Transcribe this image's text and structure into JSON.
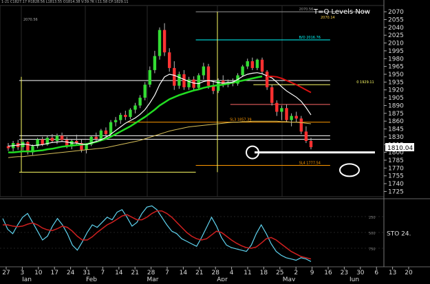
{
  "header": {
    "left_line": "1-21  C1827.17  H1828.56  L1813.55  O1814.38  V:39.7K  I:11.58  CP:1829.11",
    "sub_line": "2070.56",
    "title": "T=Q Levels Now",
    "title_sub": "2070.14"
  },
  "chart_data": [
    {
      "type": "candlestick",
      "name": "price",
      "ylim": [
        1715,
        2082
      ],
      "y_ticks": [
        2070,
        2055,
        2040,
        2025,
        2010,
        1995,
        1980,
        1965,
        1950,
        1935,
        1920,
        1905,
        1890,
        1875,
        1860,
        1845,
        1830,
        1815,
        1800,
        1785,
        1770,
        1755,
        1740,
        1725
      ],
      "last_price": "1810.04",
      "x_ticks": [
        "27",
        "3",
        "10",
        "17",
        "24",
        "31",
        "7",
        "14",
        "21",
        "28",
        "7",
        "14",
        "21",
        "28",
        "4",
        "11",
        "18",
        "25",
        "2",
        "9",
        "16",
        "23",
        "30",
        "6",
        "13",
        "20"
      ],
      "months": [
        "Jan",
        "Feb",
        "Mar",
        "Apr",
        "May",
        "Jun"
      ],
      "candles": [
        {
          "o": 1812,
          "h": 1818,
          "l": 1803,
          "c": 1808
        },
        {
          "o": 1808,
          "h": 1822,
          "l": 1802,
          "c": 1818
        },
        {
          "o": 1818,
          "h": 1824,
          "l": 1805,
          "c": 1810
        },
        {
          "o": 1810,
          "h": 1826,
          "l": 1804,
          "c": 1820
        },
        {
          "o": 1820,
          "h": 1822,
          "l": 1796,
          "c": 1800
        },
        {
          "o": 1800,
          "h": 1815,
          "l": 1795,
          "c": 1812
        },
        {
          "o": 1812,
          "h": 1828,
          "l": 1808,
          "c": 1825
        },
        {
          "o": 1825,
          "h": 1830,
          "l": 1812,
          "c": 1815
        },
        {
          "o": 1815,
          "h": 1832,
          "l": 1813,
          "c": 1828
        },
        {
          "o": 1828,
          "h": 1835,
          "l": 1818,
          "c": 1822
        },
        {
          "o": 1822,
          "h": 1836,
          "l": 1816,
          "c": 1832
        },
        {
          "o": 1832,
          "h": 1838,
          "l": 1820,
          "c": 1824
        },
        {
          "o": 1824,
          "h": 1830,
          "l": 1808,
          "c": 1812
        },
        {
          "o": 1812,
          "h": 1826,
          "l": 1806,
          "c": 1822
        },
        {
          "o": 1822,
          "h": 1834,
          "l": 1815,
          "c": 1818
        },
        {
          "o": 1818,
          "h": 1826,
          "l": 1800,
          "c": 1805
        },
        {
          "o": 1805,
          "h": 1818,
          "l": 1798,
          "c": 1815
        },
        {
          "o": 1815,
          "h": 1832,
          "l": 1812,
          "c": 1830
        },
        {
          "o": 1830,
          "h": 1838,
          "l": 1820,
          "c": 1826
        },
        {
          "o": 1826,
          "h": 1845,
          "l": 1822,
          "c": 1842
        },
        {
          "o": 1842,
          "h": 1848,
          "l": 1830,
          "c": 1835
        },
        {
          "o": 1835,
          "h": 1862,
          "l": 1832,
          "c": 1858
        },
        {
          "o": 1858,
          "h": 1868,
          "l": 1850,
          "c": 1862
        },
        {
          "o": 1862,
          "h": 1876,
          "l": 1855,
          "c": 1872
        },
        {
          "o": 1872,
          "h": 1880,
          "l": 1862,
          "c": 1868
        },
        {
          "o": 1868,
          "h": 1885,
          "l": 1864,
          "c": 1882
        },
        {
          "o": 1882,
          "h": 1895,
          "l": 1875,
          "c": 1890
        },
        {
          "o": 1890,
          "h": 1910,
          "l": 1885,
          "c": 1905
        },
        {
          "o": 1905,
          "h": 1935,
          "l": 1900,
          "c": 1930
        },
        {
          "o": 1930,
          "h": 1965,
          "l": 1925,
          "c": 1958
        },
        {
          "o": 1958,
          "h": 1995,
          "l": 1952,
          "c": 1985
        },
        {
          "o": 1985,
          "h": 2040,
          "l": 1978,
          "c": 2035
        },
        {
          "o": 2035,
          "h": 2048,
          "l": 1985,
          "c": 1992
        },
        {
          "o": 1992,
          "h": 2000,
          "l": 1955,
          "c": 1962
        },
        {
          "o": 1962,
          "h": 1975,
          "l": 1920,
          "c": 1928
        },
        {
          "o": 1928,
          "h": 1955,
          "l": 1922,
          "c": 1950
        },
        {
          "o": 1950,
          "h": 1958,
          "l": 1920,
          "c": 1925
        },
        {
          "o": 1925,
          "h": 1945,
          "l": 1920,
          "c": 1940
        },
        {
          "o": 1940,
          "h": 1946,
          "l": 1918,
          "c": 1924
        },
        {
          "o": 1924,
          "h": 1952,
          "l": 1920,
          "c": 1948
        },
        {
          "o": 1948,
          "h": 1972,
          "l": 1940,
          "c": 1965
        },
        {
          "o": 1965,
          "h": 1970,
          "l": 1922,
          "c": 1928
        },
        {
          "o": 1928,
          "h": 1938,
          "l": 1912,
          "c": 1918
        },
        {
          "o": 1918,
          "h": 1942,
          "l": 1914,
          "c": 1938
        },
        {
          "o": 1938,
          "h": 1948,
          "l": 1925,
          "c": 1930
        },
        {
          "o": 1930,
          "h": 1940,
          "l": 1925,
          "c": 1935
        },
        {
          "o": 1935,
          "h": 1942,
          "l": 1927,
          "c": 1932
        },
        {
          "o": 1932,
          "h": 1952,
          "l": 1928,
          "c": 1948
        },
        {
          "o": 1948,
          "h": 1968,
          "l": 1945,
          "c": 1965
        },
        {
          "o": 1965,
          "h": 1980,
          "l": 1960,
          "c": 1975
        },
        {
          "o": 1975,
          "h": 1982,
          "l": 1958,
          "c": 1962
        },
        {
          "o": 1962,
          "h": 1980,
          "l": 1958,
          "c": 1978
        },
        {
          "o": 1978,
          "h": 1982,
          "l": 1950,
          "c": 1955
        },
        {
          "o": 1955,
          "h": 1958,
          "l": 1920,
          "c": 1925
        },
        {
          "o": 1925,
          "h": 1930,
          "l": 1890,
          "c": 1895
        },
        {
          "o": 1895,
          "h": 1900,
          "l": 1870,
          "c": 1878
        },
        {
          "o": 1878,
          "h": 1890,
          "l": 1862,
          "c": 1885
        },
        {
          "o": 1885,
          "h": 1892,
          "l": 1858,
          "c": 1862
        },
        {
          "o": 1862,
          "h": 1875,
          "l": 1850,
          "c": 1870
        },
        {
          "o": 1870,
          "h": 1878,
          "l": 1858,
          "c": 1865
        },
        {
          "o": 1865,
          "h": 1870,
          "l": 1835,
          "c": 1840
        },
        {
          "o": 1840,
          "h": 1850,
          "l": 1818,
          "c": 1822
        },
        {
          "o": 1822,
          "h": 1828,
          "l": 1806,
          "c": 1810
        }
      ],
      "sma_white": [
        1812,
        1813,
        1814,
        1816,
        1815,
        1813,
        1814,
        1815,
        1817,
        1819,
        1820,
        1821,
        1820,
        1818,
        1818,
        1816,
        1815,
        1818,
        1821,
        1824,
        1829,
        1835,
        1842,
        1849,
        1856,
        1861,
        1866,
        1873,
        1882,
        1895,
        1910,
        1930,
        1945,
        1950,
        1948,
        1944,
        1940,
        1936,
        1933,
        1932,
        1936,
        1938,
        1936,
        1934,
        1933,
        1934,
        1935,
        1940,
        1946,
        1950,
        1952,
        1953,
        1951,
        1947,
        1943,
        1935,
        1926,
        1918,
        1912,
        1906,
        1898,
        1886,
        1872
      ],
      "sma_green": [
        1800,
        1800,
        1801,
        1802,
        1802,
        1802,
        1803,
        1804,
        1806,
        1807,
        1809,
        1811,
        1812,
        1813,
        1814,
        1815,
        1816,
        1818,
        1820,
        1823,
        1826,
        1830,
        1835,
        1840,
        1845,
        1850,
        1856,
        1862,
        1868,
        1875,
        1882,
        1890,
        1896,
        1902,
        1906,
        1910,
        1913,
        1916,
        1919,
        1921,
        1924,
        1926,
        1928,
        1929,
        1930,
        1932,
        1934,
        1936,
        1938,
        1940,
        1942,
        1944,
        1946
      ],
      "sma_red": [
        1946,
        1946,
        1945,
        1942,
        1938,
        1934,
        1930,
        1925,
        1920,
        1915
      ],
      "sma_yellow": [
        1790,
        1791,
        1792,
        1792,
        1793,
        1794,
        1795,
        1796,
        1797,
        1798,
        1799,
        1800,
        1801,
        1802,
        1803,
        1804,
        1805,
        1806,
        1807,
        1808,
        1809,
        1811,
        1813,
        1815,
        1817,
        1819,
        1821,
        1823,
        1826,
        1829,
        1832,
        1835,
        1838,
        1841,
        1843,
        1845,
        1847,
        1849,
        1850,
        1851,
        1852,
        1853,
        1854,
        1855,
        1856,
        1857,
        1858,
        1858,
        1859,
        1859,
        1860,
        1860,
        1860,
        1860,
        1860,
        1860,
        1859,
        1859,
        1858,
        1858,
        1857,
        1856,
        1855
      ],
      "levels": [
        {
          "y": 2070,
          "color": "#9a9a9a",
          "from": 0.51,
          "to": 0.96,
          "label": "2070.56"
        },
        {
          "y": 2016,
          "color": "#00ffff",
          "from": 0.51,
          "to": 0.86,
          "label": "B/O  2016.76"
        },
        {
          "y": 1938,
          "color": "#ffffff",
          "from": 0.05,
          "to": 0.86,
          "label": ""
        },
        {
          "y": 1930,
          "color": "#ffff66",
          "from": 0.66,
          "to": 0.86,
          "label": "0  1929.11"
        },
        {
          "y": 1892,
          "color": "#ff6666",
          "from": 0.6,
          "to": 0.86,
          "label": ""
        },
        {
          "y": 1858,
          "color": "#ff9900",
          "from": 0.33,
          "to": 0.86,
          "label": "SL3  1857.39"
        },
        {
          "y": 1832,
          "color": "#ffffff",
          "from": 0.05,
          "to": 0.86,
          "label": ""
        },
        {
          "y": 1825,
          "color": "#ffffff",
          "from": 0.05,
          "to": 0.86,
          "label": ""
        },
        {
          "y": 1775,
          "color": "#ff9900",
          "from": 0.51,
          "to": 0.86,
          "label": "SL4  1777.54"
        },
        {
          "y": 1762,
          "color": "#ffff66",
          "from": 0.05,
          "to": 0.51,
          "label": ""
        }
      ]
    },
    {
      "type": "line",
      "name": "stochastic",
      "label": "STO",
      "last_value": "24.",
      "ylim": [
        0,
        100
      ],
      "y_ticks": [
        "250",
        "500",
        "750"
      ],
      "series": [
        {
          "color": "#5fd4f0",
          "values": [
            72,
            55,
            48,
            62,
            74,
            80,
            66,
            52,
            38,
            44,
            60,
            72,
            62,
            48,
            30,
            22,
            35,
            50,
            62,
            58,
            66,
            74,
            70,
            82,
            86,
            74,
            60,
            66,
            80,
            90,
            92,
            86,
            74,
            62,
            52,
            48,
            40,
            36,
            32,
            28,
            42,
            58,
            74,
            60,
            42,
            30,
            26,
            24,
            22,
            20,
            30,
            48,
            62,
            48,
            32,
            20,
            14,
            10,
            8,
            6,
            10,
            8,
            4
          ]
        },
        {
          "color": "#d02020",
          "values": [
            62,
            62,
            60,
            59,
            60,
            63,
            65,
            62,
            57,
            54,
            53,
            56,
            60,
            58,
            52,
            44,
            38,
            38,
            43,
            50,
            56,
            62,
            66,
            71,
            76,
            78,
            74,
            70,
            70,
            74,
            80,
            84,
            84,
            80,
            74,
            66,
            58,
            50,
            44,
            40,
            38,
            40,
            46,
            52,
            50,
            44,
            38,
            33,
            29,
            26,
            25,
            27,
            33,
            40,
            42,
            38,
            32,
            26,
            20,
            16,
            12,
            10,
            8
          ]
        }
      ]
    }
  ]
}
